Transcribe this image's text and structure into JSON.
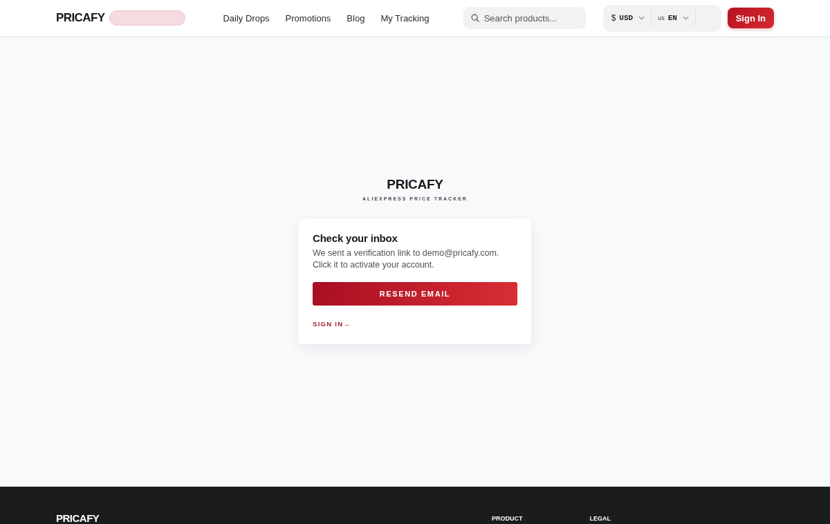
{
  "header": {
    "logo": "PRICAFY",
    "nav": [
      "Daily Drops",
      "Promotions",
      "Blog",
      "My Tracking"
    ],
    "search": {
      "placeholder": "Search products..."
    },
    "currency": {
      "symbol": "$",
      "code": "USD"
    },
    "language": {
      "region": "us",
      "code": "EN"
    },
    "sign_in_button": "Sign In"
  },
  "brand": {
    "name": "PRICAFY",
    "tagline": "ALIEXPRESS PRICE TRACKER"
  },
  "card": {
    "title": "Check your inbox",
    "message": "We sent a verification link to demo@pricafy.com. Click it to activate your account.",
    "button": "RESEND EMAIL",
    "link": "SIGN IN→"
  },
  "footer": {
    "logo": "PRICAFY",
    "columns": [
      "PRODUCT",
      "LEGAL"
    ]
  }
}
